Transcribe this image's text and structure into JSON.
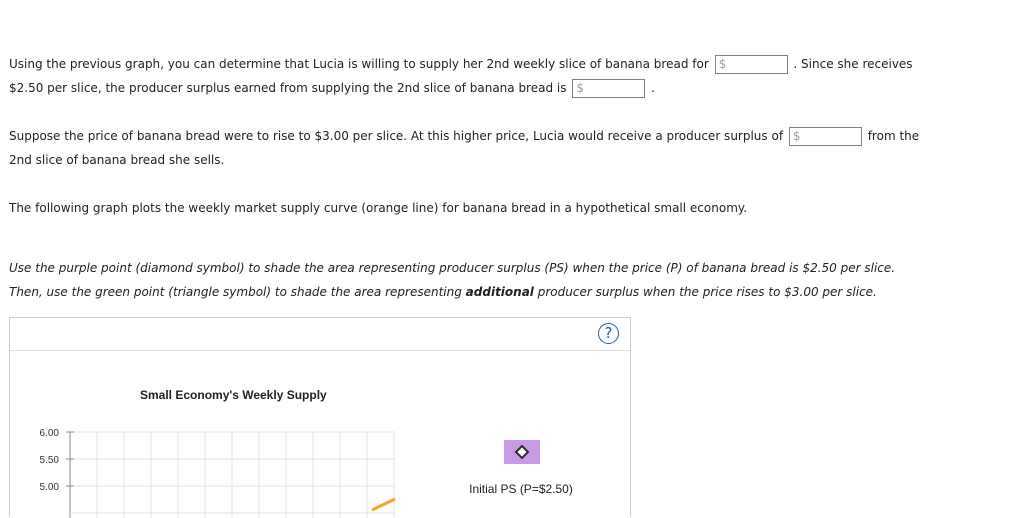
{
  "question": {
    "p1_a": "Using the previous graph, you can determine that Lucia is willing to supply her 2nd weekly slice of banana bread for",
    "p1_b": ". Since she receives",
    "p1_c": "$2.50 per slice, the producer surplus earned from supplying the 2nd slice of banana bread is",
    "p1_d": ".",
    "p2_a": "Suppose the price of banana bread were to rise to $3.00 per slice. At this higher price, Lucia would receive a producer surplus of",
    "p2_b": "from the",
    "p2_c": "2nd slice of banana bread she sells.",
    "p3": "The following graph plots the weekly market supply curve (orange line) for banana bread in a hypothetical small economy.",
    "i1": "Use the purple point (diamond symbol) to shade the area representing producer surplus (PS) when the price (P) of banana bread is $2.50 per slice.",
    "i2_a": "Then, use the green point (triangle symbol) to shade the area representing ",
    "i2_b": "additional",
    "i2_c": " producer surplus when the price rises to $3.00 per slice."
  },
  "inputs": {
    "currency": "$",
    "willing_price": "",
    "ps_at_2_50": "",
    "ps_at_3_00": ""
  },
  "panel": {
    "help": "?"
  },
  "chart_data": {
    "type": "line",
    "title": "Small Economy's Weekly Supply",
    "yticks": [
      "6.00",
      "5.50",
      "5.00"
    ],
    "series": [
      {
        "name": "Supply",
        "color": "#f5a623"
      }
    ],
    "tools": [
      {
        "label": "Initial PS (P=$2.50)",
        "symbol": "diamond-icon",
        "color": "#c89ae6"
      }
    ]
  }
}
